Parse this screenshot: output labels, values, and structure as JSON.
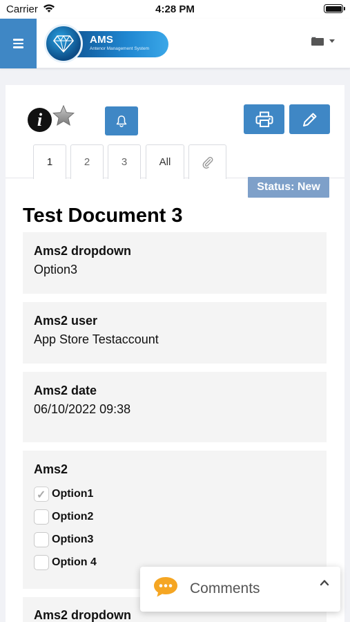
{
  "status_bar": {
    "carrier": "Carrier",
    "time": "4:28 PM"
  },
  "header": {
    "logo_title": "AMS",
    "logo_subtitle": "Antenor Management System"
  },
  "toolbar": {
    "tabs": [
      "1",
      "2",
      "3",
      "All"
    ],
    "active_tab": "1"
  },
  "status_badge": "Status: New",
  "document": {
    "title": "Test Document 3",
    "fields": [
      {
        "label": "Ams2 dropdown",
        "value": "Option3"
      },
      {
        "label": "Ams2 user",
        "value": "App Store Testaccount"
      },
      {
        "label": "Ams2 date",
        "value": "06/10/2022 09:38"
      }
    ],
    "checkbox_group": {
      "label": "Ams2",
      "options": [
        {
          "label": "Option1",
          "checked": true
        },
        {
          "label": "Option2",
          "checked": false
        },
        {
          "label": "Option3",
          "checked": false
        },
        {
          "label": "Option 4",
          "checked": false
        }
      ]
    },
    "next_field_label": "Ams2 dropdown"
  },
  "comments": {
    "label": "Comments"
  },
  "colors": {
    "primary": "#3f87c5",
    "status_badge": "#7ea0c9"
  }
}
